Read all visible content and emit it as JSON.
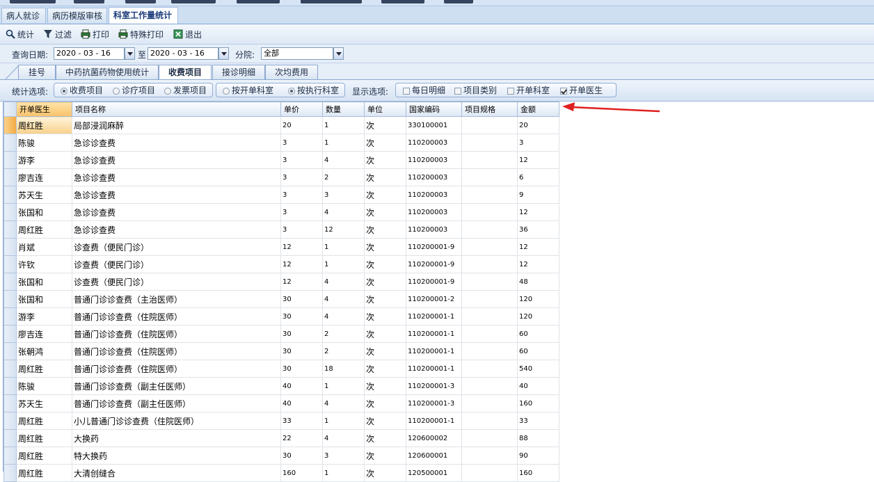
{
  "doc_tabs": [
    {
      "label": "病人就诊",
      "active": false
    },
    {
      "label": "病历模版审核",
      "active": false
    },
    {
      "label": "科室工作量统计",
      "active": true
    }
  ],
  "toolbar": {
    "stats": {
      "label": "统计",
      "icon": "magnifier-icon"
    },
    "filter": {
      "label": "过滤",
      "icon": "funnel-icon"
    },
    "print": {
      "label": "打印",
      "icon": "printer-icon"
    },
    "special_print": {
      "label": "特殊打印",
      "icon": "printer-icon"
    },
    "exit": {
      "label": "退出",
      "icon": "exit-icon"
    }
  },
  "query": {
    "date_label": "查询日期:",
    "start_date": "2020 - 03 - 16",
    "to_label": "至",
    "end_date": "2020 - 03 - 16",
    "branch_label": "分院:",
    "branch_value": "全部"
  },
  "sub_tabs": [
    {
      "label": "挂号",
      "active": false
    },
    {
      "label": "中药抗菌药物使用统计",
      "active": false
    },
    {
      "label": "收费项目",
      "active": true
    },
    {
      "label": "接诊明细",
      "active": false
    },
    {
      "label": "次均费用",
      "active": false
    }
  ],
  "options": {
    "stat_label": "统计选项:",
    "stat_items": [
      {
        "label": "收费项目",
        "selected": true
      },
      {
        "label": "诊疗项目",
        "selected": false
      },
      {
        "label": "发票项目",
        "selected": false
      }
    ],
    "dept_items": [
      {
        "label": "按开单科室",
        "selected": false
      },
      {
        "label": "按执行科室",
        "selected": true
      }
    ],
    "display_label": "显示选项:",
    "display_items": [
      {
        "label": "每日明细",
        "checked": false
      },
      {
        "label": "项目类别",
        "checked": false
      },
      {
        "label": "开单科室",
        "checked": false
      },
      {
        "label": "开单医生",
        "checked": true
      }
    ]
  },
  "table": {
    "columns": [
      "开单医生",
      "项目名称",
      "单价",
      "数量",
      "单位",
      "国家编码",
      "项目规格",
      "金额"
    ],
    "rows": [
      [
        "周红胜",
        "局部浸润麻醉",
        "20",
        "1",
        "次",
        "330100001",
        "",
        "20"
      ],
      [
        "陈骏",
        "急诊诊查费",
        "3",
        "1",
        "次",
        "110200003",
        "",
        "3"
      ],
      [
        "游李",
        "急诊诊查费",
        "3",
        "4",
        "次",
        "110200003",
        "",
        "12"
      ],
      [
        "廖吉连",
        "急诊诊查费",
        "3",
        "2",
        "次",
        "110200003",
        "",
        "6"
      ],
      [
        "苏天生",
        "急诊诊查费",
        "3",
        "3",
        "次",
        "110200003",
        "",
        "9"
      ],
      [
        "张国和",
        "急诊诊查费",
        "3",
        "4",
        "次",
        "110200003",
        "",
        "12"
      ],
      [
        "周红胜",
        "急诊诊查费",
        "3",
        "12",
        "次",
        "110200003",
        "",
        "36"
      ],
      [
        "肖斌",
        "诊查费（便民门诊）",
        "12",
        "1",
        "次",
        "110200001-9",
        "",
        "12"
      ],
      [
        "许钦",
        "诊查费（便民门诊）",
        "12",
        "1",
        "次",
        "110200001-9",
        "",
        "12"
      ],
      [
        "张国和",
        "诊查费（便民门诊）",
        "12",
        "4",
        "次",
        "110200001-9",
        "",
        "48"
      ],
      [
        "张国和",
        "普通门诊诊查费（主治医师）",
        "30",
        "4",
        "次",
        "110200001-2",
        "",
        "120"
      ],
      [
        "游李",
        "普通门诊诊查费（住院医师）",
        "30",
        "4",
        "次",
        "110200001-1",
        "",
        "120"
      ],
      [
        "廖吉连",
        "普通门诊诊查费（住院医师）",
        "30",
        "2",
        "次",
        "110200001-1",
        "",
        "60"
      ],
      [
        "张朝鸿",
        "普通门诊诊查费（住院医师）",
        "30",
        "2",
        "次",
        "110200001-1",
        "",
        "60"
      ],
      [
        "周红胜",
        "普通门诊诊查费（住院医师）",
        "30",
        "18",
        "次",
        "110200001-1",
        "",
        "540"
      ],
      [
        "陈骏",
        "普通门诊诊查费（副主任医师）",
        "40",
        "1",
        "次",
        "110200001-3",
        "",
        "40"
      ],
      [
        "苏天生",
        "普通门诊诊查费（副主任医师）",
        "40",
        "4",
        "次",
        "110200001-3",
        "",
        "160"
      ],
      [
        "周红胜",
        "小儿普通门诊诊查费（住院医师）",
        "33",
        "1",
        "次",
        "110200001-1",
        "",
        "33"
      ],
      [
        "周红胜",
        "大换药",
        "22",
        "4",
        "次",
        "120600002",
        "",
        "88"
      ],
      [
        "周红胜",
        "特大换药",
        "30",
        "3",
        "次",
        "120600001",
        "",
        "90"
      ],
      [
        "周红胜",
        "大清创缝合",
        "160",
        "1",
        "次",
        "120500001",
        "",
        "160"
      ]
    ]
  },
  "colors": {
    "arrow": "#e02020",
    "sorted_header": "#f8c26a"
  }
}
